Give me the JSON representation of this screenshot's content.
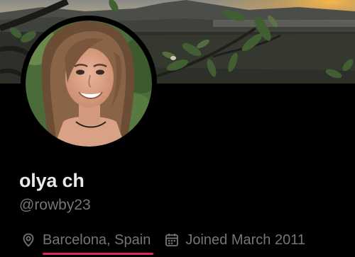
{
  "profile": {
    "display_name": "olya ch",
    "handle": "@rowby23",
    "location": "Barcelona, Spain",
    "joined": "Joined March 2011"
  },
  "icons": {
    "location": "location-pin-icon",
    "joined": "calendar-icon"
  },
  "colors": {
    "background": "#000000",
    "name_text": "#e7e9ea",
    "secondary_text": "#71767b",
    "underline": "#e0245e"
  }
}
